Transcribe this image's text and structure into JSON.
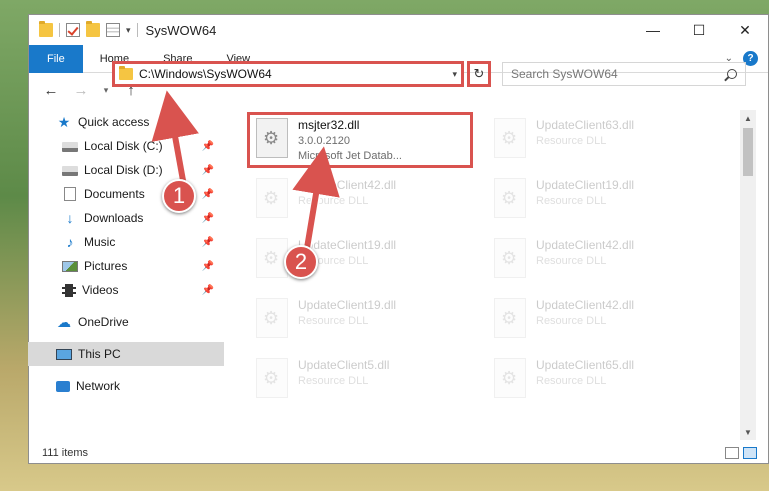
{
  "window": {
    "title": "SysWOW64",
    "minimize": "—",
    "maximize": "☐",
    "close": "✕"
  },
  "ribbon": {
    "tabs": [
      "File",
      "Home",
      "Share",
      "View"
    ]
  },
  "navbar": {
    "back": "←",
    "forward": "→",
    "recent": "▾",
    "up": "↑",
    "address": "C:\\Windows\\SysWOW64",
    "refresh": "↻",
    "search_placeholder": "Search SysWOW64"
  },
  "sidebar": {
    "quick_access": "Quick access",
    "items": [
      {
        "label": "Local Disk (C:)",
        "icon": "disk-icon"
      },
      {
        "label": "Local Disk (D:)",
        "icon": "disk-icon"
      },
      {
        "label": "Documents",
        "icon": "documents-icon"
      },
      {
        "label": "Downloads",
        "icon": "downloads-icon"
      },
      {
        "label": "Music",
        "icon": "music-icon"
      },
      {
        "label": "Pictures",
        "icon": "pictures-icon"
      },
      {
        "label": "Videos",
        "icon": "videos-icon"
      }
    ],
    "onedrive": "OneDrive",
    "this_pc": "This PC",
    "network": "Network"
  },
  "files": {
    "primary": {
      "name": "msjter32.dll",
      "version": "3.0.0.2120",
      "description": "Microsoft Jet Datab..."
    },
    "right": [
      {
        "name": "UpdateClient63.dll",
        "type": "Resource DLL"
      },
      {
        "name": "UpdateClient19.dll",
        "type": "Resource DLL"
      },
      {
        "name": "UpdateClient42.dll",
        "type": "Resource DLL"
      },
      {
        "name": "UpdateClient42.dll",
        "type": "Resource DLL"
      },
      {
        "name": "UpdateClient65.dll",
        "type": "Resource DLL"
      }
    ],
    "left": [
      {
        "name": "UpdateClient42.dll",
        "type": "Resource DLL"
      },
      {
        "name": "UpdateClient19.dll",
        "type": "Resource DLL"
      },
      {
        "name": "UpdateClient19.dll",
        "type": "Resource DLL"
      },
      {
        "name": "UpdateClient5.dll",
        "type": "Resource DLL"
      }
    ]
  },
  "status": {
    "count": "111 items"
  },
  "callouts": {
    "one": "1",
    "two": "2"
  },
  "colors": {
    "accent": "#1979ca",
    "highlight": "#d9534f"
  }
}
